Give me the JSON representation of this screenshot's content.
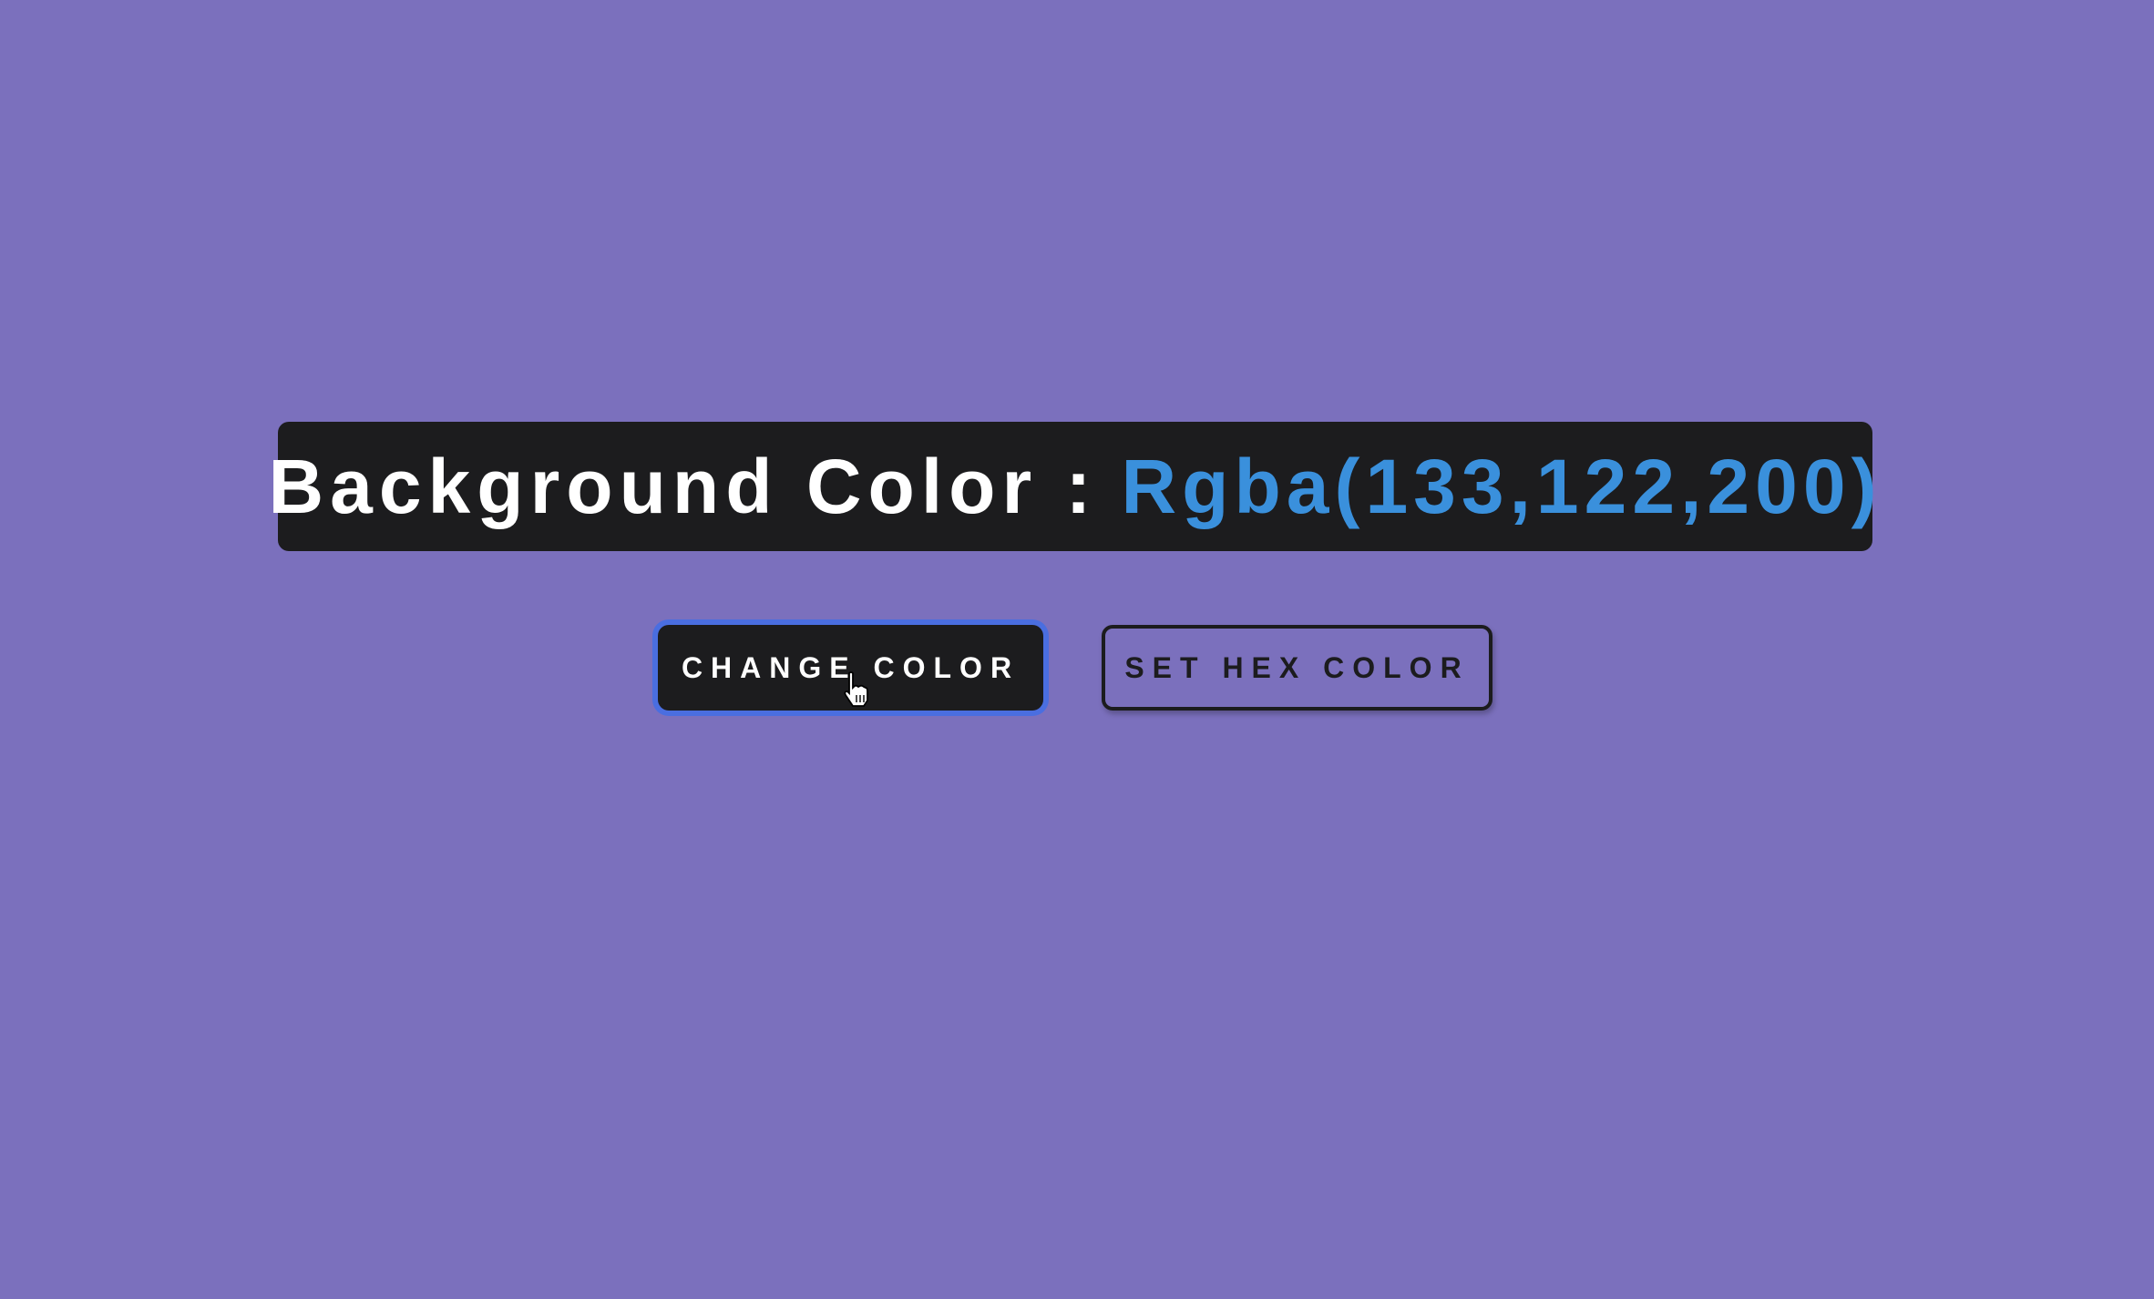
{
  "header": {
    "label": "Background Color :",
    "value": "Rgba(133,122,200)"
  },
  "buttons": {
    "change_color": "CHANGE COLOR",
    "set_hex_color": "SET HEX COLOR"
  },
  "colors": {
    "background": "#857ac8",
    "accent": "#3a90dc",
    "dark": "#1c1c1e"
  }
}
